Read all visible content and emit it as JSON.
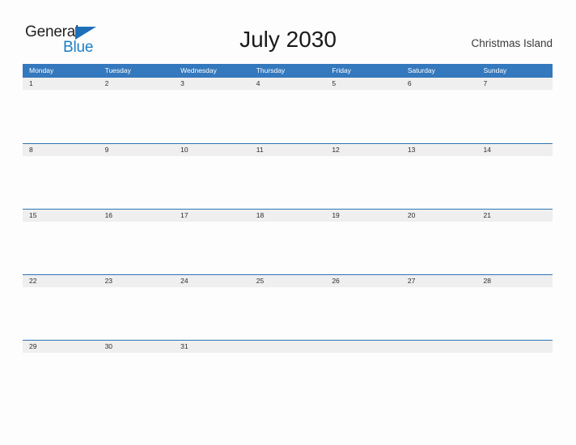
{
  "brand": {
    "name_part1": "General",
    "name_part2": "Blue",
    "color_dark": "#231f20",
    "color_blue": "#1d7dc4",
    "flag_icon": "triangle-flag-icon"
  },
  "header": {
    "title": "July 2030",
    "location": "Christmas Island"
  },
  "calendar": {
    "accent_color": "#3478bd",
    "band_color": "#efefef",
    "border_color": "#2e74b5",
    "weekdays": [
      "Monday",
      "Tuesday",
      "Wednesday",
      "Thursday",
      "Friday",
      "Saturday",
      "Sunday"
    ],
    "weeks": [
      [
        "1",
        "2",
        "3",
        "4",
        "5",
        "6",
        "7"
      ],
      [
        "8",
        "9",
        "10",
        "11",
        "12",
        "13",
        "14"
      ],
      [
        "15",
        "16",
        "17",
        "18",
        "19",
        "20",
        "21"
      ],
      [
        "22",
        "23",
        "24",
        "25",
        "26",
        "27",
        "28"
      ],
      [
        "29",
        "30",
        "31",
        "",
        "",
        "",
        ""
      ]
    ]
  }
}
